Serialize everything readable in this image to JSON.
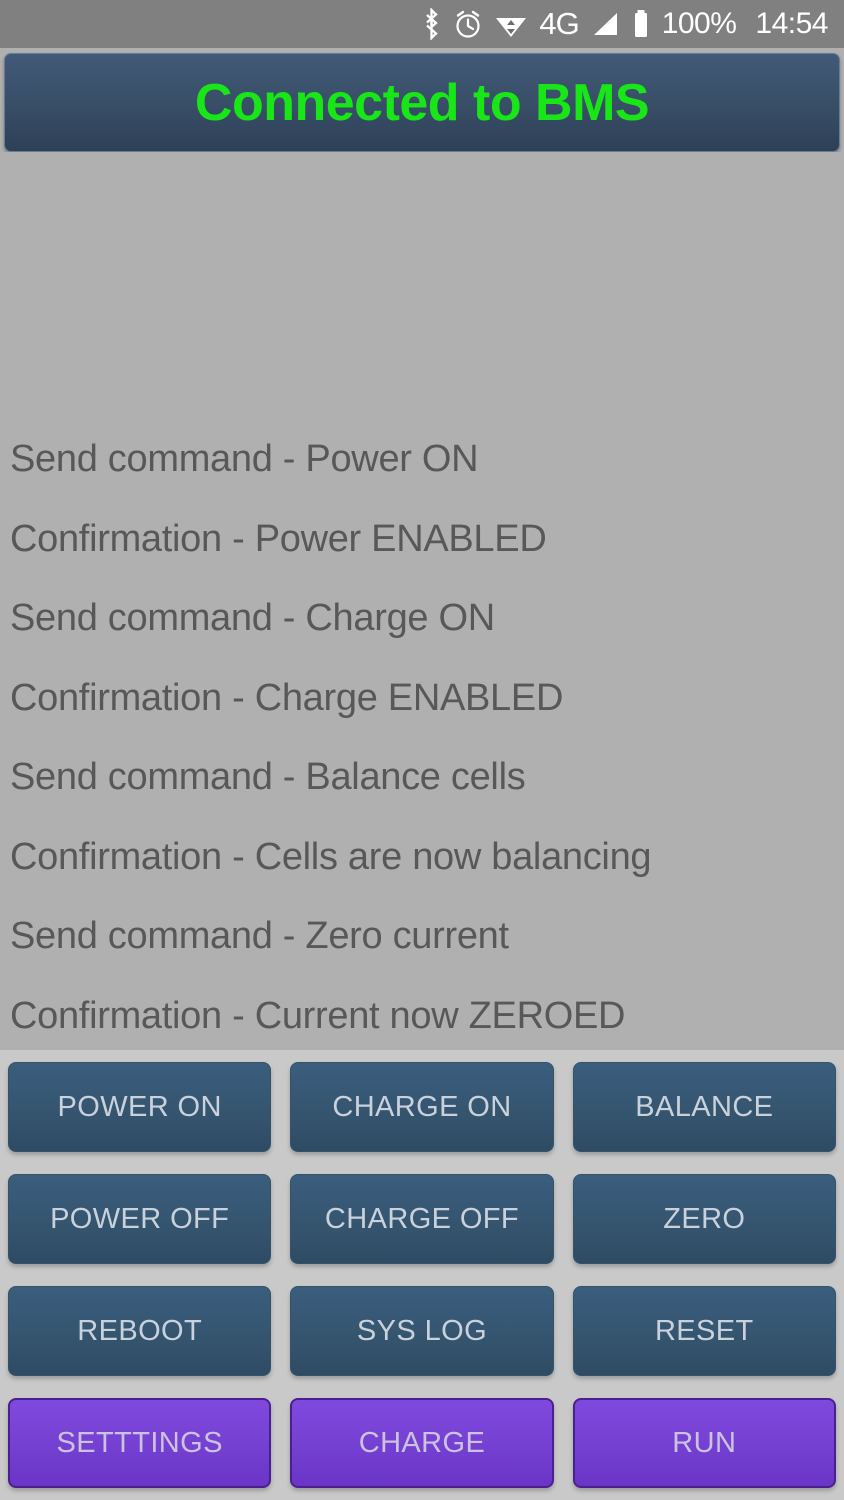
{
  "status_bar": {
    "icons": [
      {
        "name": "bluetooth-icon",
        "label": "bluetooth"
      },
      {
        "name": "alarm-clock-icon",
        "label": "alarm"
      },
      {
        "name": "wifi-icon",
        "label": "wifi"
      },
      {
        "name": "network-4g-icon",
        "label": "4G"
      },
      {
        "name": "signal-bars-icon",
        "label": "signal"
      },
      {
        "name": "battery-icon",
        "label": "battery"
      }
    ],
    "network_type": "4G",
    "battery_percent": "100%",
    "clock": "14:54"
  },
  "header": {
    "title": "Connected to BMS",
    "title_color": "#18e617",
    "panel_color": "#3a5069"
  },
  "log": {
    "lines": [
      "Send command - Power ON",
      "Confirmation - Power ENABLED",
      "Send command - Charge ON",
      "Confirmation - Charge ENABLED",
      "Send command - Balance cells",
      "Confirmation - Cells are now balancing",
      "Send command - Zero current",
      "Confirmation - Current now ZEROED"
    ],
    "text_color": "#585858"
  },
  "buttons": {
    "blue_color": "#35556f",
    "purple_color": "#7440d2",
    "rows": [
      [
        {
          "label": "POWER ON",
          "style": "blue",
          "name": "power-on-button"
        },
        {
          "label": "CHARGE ON",
          "style": "blue",
          "name": "charge-on-button"
        },
        {
          "label": "BALANCE",
          "style": "blue",
          "name": "balance-button"
        }
      ],
      [
        {
          "label": "POWER OFF",
          "style": "blue",
          "name": "power-off-button"
        },
        {
          "label": "CHARGE OFF",
          "style": "blue",
          "name": "charge-off-button"
        },
        {
          "label": "ZERO",
          "style": "blue",
          "name": "zero-button"
        }
      ],
      [
        {
          "label": "REBOOT",
          "style": "blue",
          "name": "reboot-button"
        },
        {
          "label": "SYS LOG",
          "style": "blue",
          "name": "sys-log-button"
        },
        {
          "label": "RESET",
          "style": "blue",
          "name": "reset-button"
        }
      ],
      [
        {
          "label": "SETTTINGS",
          "style": "purple",
          "name": "settings-button"
        },
        {
          "label": "CHARGE",
          "style": "purple",
          "name": "charge-button"
        },
        {
          "label": "RUN",
          "style": "purple",
          "name": "run-button"
        }
      ]
    ]
  }
}
